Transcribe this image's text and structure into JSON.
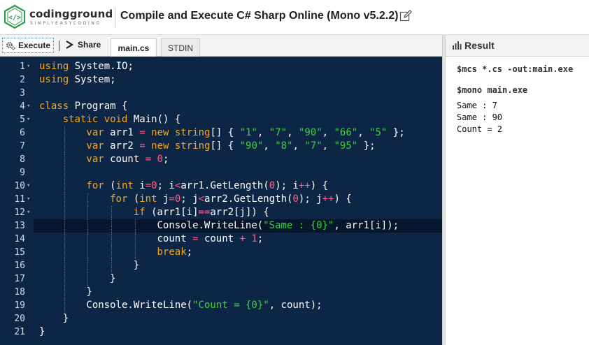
{
  "header": {
    "brand": "codingground",
    "tagline": "SIMPLYEASYCODING",
    "title": "Compile and Execute C# Sharp Online (Mono v5.2.2)"
  },
  "toolbar": {
    "execute_label": "Execute",
    "share_label": "Share",
    "tabs": [
      {
        "label": "main.cs",
        "active": true
      },
      {
        "label": "STDIN",
        "active": false
      }
    ]
  },
  "editor": {
    "active_line": 13,
    "colors": {
      "background": "#0d2646",
      "keyword": "#f5a623",
      "string": "#3dd13d",
      "number": "#ff5e8a",
      "text": "#ffffff"
    },
    "lines": [
      {
        "n": "1",
        "fold": true,
        "indent": 0,
        "tokens": [
          [
            "kw",
            "using"
          ],
          [
            "t",
            " System.IO;"
          ]
        ]
      },
      {
        "n": "2",
        "fold": false,
        "indent": 0,
        "tokens": [
          [
            "kw",
            "using"
          ],
          [
            "t",
            " System;"
          ]
        ]
      },
      {
        "n": "3",
        "fold": false,
        "indent": 0,
        "tokens": []
      },
      {
        "n": "4",
        "fold": true,
        "indent": 0,
        "tokens": [
          [
            "kw",
            "class"
          ],
          [
            "t",
            " Program {"
          ]
        ]
      },
      {
        "n": "5",
        "fold": true,
        "indent": 1,
        "tokens": [
          [
            "kw",
            "static"
          ],
          [
            "t",
            " "
          ],
          [
            "kw",
            "void"
          ],
          [
            "t",
            " Main() {"
          ]
        ]
      },
      {
        "n": "6",
        "fold": false,
        "indent": 2,
        "tokens": [
          [
            "kw",
            "var"
          ],
          [
            "t",
            " arr1 "
          ],
          [
            "op",
            "="
          ],
          [
            "t",
            " "
          ],
          [
            "kw",
            "new"
          ],
          [
            "t",
            " "
          ],
          [
            "kw",
            "string"
          ],
          [
            "t",
            "[] { "
          ],
          [
            "str",
            "\"1\""
          ],
          [
            "t",
            ", "
          ],
          [
            "str",
            "\"7\""
          ],
          [
            "t",
            ", "
          ],
          [
            "str",
            "\"90\""
          ],
          [
            "t",
            ", "
          ],
          [
            "str",
            "\"66\""
          ],
          [
            "t",
            ", "
          ],
          [
            "str",
            "\"5\""
          ],
          [
            "t",
            " };"
          ]
        ]
      },
      {
        "n": "7",
        "fold": false,
        "indent": 2,
        "tokens": [
          [
            "kw",
            "var"
          ],
          [
            "t",
            " arr2 "
          ],
          [
            "op",
            "="
          ],
          [
            "t",
            " "
          ],
          [
            "kw",
            "new"
          ],
          [
            "t",
            " "
          ],
          [
            "kw",
            "string"
          ],
          [
            "t",
            "[] { "
          ],
          [
            "str",
            "\"90\""
          ],
          [
            "t",
            ", "
          ],
          [
            "str",
            "\"8\""
          ],
          [
            "t",
            ", "
          ],
          [
            "str",
            "\"7\""
          ],
          [
            "t",
            ", "
          ],
          [
            "str",
            "\"95\""
          ],
          [
            "t",
            " };"
          ]
        ]
      },
      {
        "n": "8",
        "fold": false,
        "indent": 2,
        "tokens": [
          [
            "kw",
            "var"
          ],
          [
            "t",
            " count "
          ],
          [
            "op",
            "="
          ],
          [
            "t",
            " "
          ],
          [
            "num",
            "0"
          ],
          [
            "t",
            ";"
          ]
        ]
      },
      {
        "n": "9",
        "fold": false,
        "indent": 2,
        "tokens": []
      },
      {
        "n": "10",
        "fold": true,
        "indent": 2,
        "tokens": [
          [
            "kw",
            "for"
          ],
          [
            "t",
            " ("
          ],
          [
            "kw",
            "int"
          ],
          [
            "t",
            " i"
          ],
          [
            "op",
            "="
          ],
          [
            "num",
            "0"
          ],
          [
            "t",
            "; i"
          ],
          [
            "op",
            "<"
          ],
          [
            "t",
            "arr1.GetLength("
          ],
          [
            "num",
            "0"
          ],
          [
            "t",
            "); i"
          ],
          [
            "op",
            "++"
          ],
          [
            "t",
            ") {"
          ]
        ]
      },
      {
        "n": "11",
        "fold": true,
        "indent": 3,
        "tokens": [
          [
            "kw",
            "for"
          ],
          [
            "t",
            " ("
          ],
          [
            "kw",
            "int"
          ],
          [
            "t",
            " j"
          ],
          [
            "op",
            "="
          ],
          [
            "num",
            "0"
          ],
          [
            "t",
            "; j"
          ],
          [
            "op",
            "<"
          ],
          [
            "t",
            "arr2.GetLength("
          ],
          [
            "num",
            "0"
          ],
          [
            "t",
            "); j"
          ],
          [
            "op",
            "++"
          ],
          [
            "t",
            ") {"
          ]
        ]
      },
      {
        "n": "12",
        "fold": true,
        "indent": 4,
        "tokens": [
          [
            "kw",
            "if"
          ],
          [
            "t",
            " (arr1[i]"
          ],
          [
            "op",
            "=="
          ],
          [
            "t",
            "arr2[j]) {"
          ]
        ]
      },
      {
        "n": "13",
        "fold": false,
        "indent": 5,
        "tokens": [
          [
            "t",
            "Console.WriteLine("
          ],
          [
            "str",
            "\"Same : {0}\""
          ],
          [
            "t",
            ", arr1[i]);"
          ]
        ]
      },
      {
        "n": "14",
        "fold": false,
        "indent": 5,
        "tokens": [
          [
            "t",
            "count "
          ],
          [
            "op",
            "="
          ],
          [
            "t",
            " count "
          ],
          [
            "op",
            "+"
          ],
          [
            "t",
            " "
          ],
          [
            "num",
            "1"
          ],
          [
            "t",
            ";"
          ]
        ]
      },
      {
        "n": "15",
        "fold": false,
        "indent": 5,
        "tokens": [
          [
            "kw",
            "break"
          ],
          [
            "t",
            ";"
          ]
        ]
      },
      {
        "n": "16",
        "fold": false,
        "indent": 4,
        "tokens": [
          [
            "t",
            "}"
          ]
        ]
      },
      {
        "n": "17",
        "fold": false,
        "indent": 3,
        "tokens": [
          [
            "t",
            "}"
          ]
        ]
      },
      {
        "n": "18",
        "fold": false,
        "indent": 2,
        "tokens": [
          [
            "t",
            "}"
          ]
        ]
      },
      {
        "n": "19",
        "fold": false,
        "indent": 2,
        "tokens": [
          [
            "t",
            "Console.WriteLine("
          ],
          [
            "str",
            "\"Count = {0}\""
          ],
          [
            "t",
            ", count);"
          ]
        ]
      },
      {
        "n": "20",
        "fold": false,
        "indent": 1,
        "tokens": [
          [
            "t",
            "}"
          ]
        ]
      },
      {
        "n": "21",
        "fold": false,
        "indent": 0,
        "tokens": [
          [
            "t",
            "}"
          ]
        ]
      }
    ]
  },
  "result": {
    "title": "Result",
    "compile_cmd": "$mcs *.cs -out:main.exe",
    "run_cmd": "$mono main.exe",
    "output": [
      "Same : 7",
      "Same : 90",
      "Count = 2"
    ]
  }
}
